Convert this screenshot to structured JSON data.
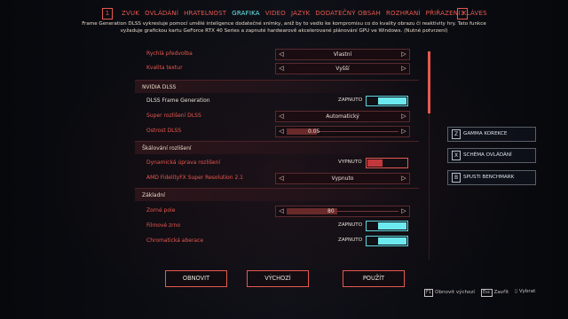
{
  "tabs": {
    "left_key": "1",
    "right_key": "3",
    "items": [
      "ZVUK",
      "OVLÁDÁNÍ",
      "HRATELNOST",
      "GRAFIKA",
      "VIDEO",
      "JAZYK",
      "DODATEČNÝ OBSAH",
      "ROZHRANÍ",
      "PŘIŘAZENÍ KLÁVES"
    ],
    "active": "GRAFIKA"
  },
  "description": "Frame Generation DLSS vykresluje pomocí umělé inteligence dodatečné snímky, aniž by to vedlo ke kompromisu co do kvality obrazu či reaktivity hry. Tato funkce vyžaduje grafickou kartu GeForce RTX 40 Series a zapnuté hardwarově akcelerované plánování GPU ve Windows. (Nutné potvrzení)",
  "settings": {
    "rychly_predvolba": {
      "label": "Rychlá předvolba",
      "value": "Vlastní"
    },
    "kvalita_textur": {
      "label": "Kvalita textur",
      "value": "Vyšší"
    },
    "section_nvidia": "NVIDIA DLSS",
    "dlss_frame_gen": {
      "label": "DLSS Frame Generation",
      "state": "ZAPNUTO"
    },
    "super_rozliseni": {
      "label": "Super rozlišení DLSS",
      "value": "Automatický"
    },
    "ostrost": {
      "label": "Ostrost DLSS",
      "value": "0.05",
      "fraction": 0.27
    },
    "section_skalovani": "Škálování rozlišení",
    "dynamicke": {
      "label": "Dynamická úprava rozlišení",
      "state": "VYPNUTO"
    },
    "fsr": {
      "label": "AMD FidelityFX Super Resolution 2.1",
      "value": "Vypnuto"
    },
    "section_zakladni": "Základní",
    "zorne_pole": {
      "label": "Zorné pole",
      "value": "80",
      "fraction": 0.45
    },
    "filmove_zrno": {
      "label": "Filmové zrno",
      "state": "ZAPNUTO"
    },
    "chromaticka": {
      "label": "Chromatická aberace",
      "state": "ZAPNUTO"
    }
  },
  "side": {
    "gamma": {
      "key": "Z",
      "label": "GAMMA KOREKCE"
    },
    "schema": {
      "key": "X",
      "label": "SCHÉMA OVLÁDÁNÍ"
    },
    "benchmark": {
      "key": "B",
      "label": "SPUSTI BENCHMARK"
    }
  },
  "buttons": {
    "obnovit": "OBNOVIT",
    "vychozi": "VÝCHOZÍ",
    "pouzit": "POUŽÍT"
  },
  "hints": {
    "obnovit_key": "F1",
    "obnovit_label": "Obnovit výchozí",
    "zavrit_key": "Esc",
    "zavrit_label": "Zavřít",
    "vybrat_label": "Vybrat"
  },
  "colors": {
    "accent_red": "#e8584f",
    "accent_cyan": "#6ce9ef",
    "background": "#0c0e14"
  }
}
